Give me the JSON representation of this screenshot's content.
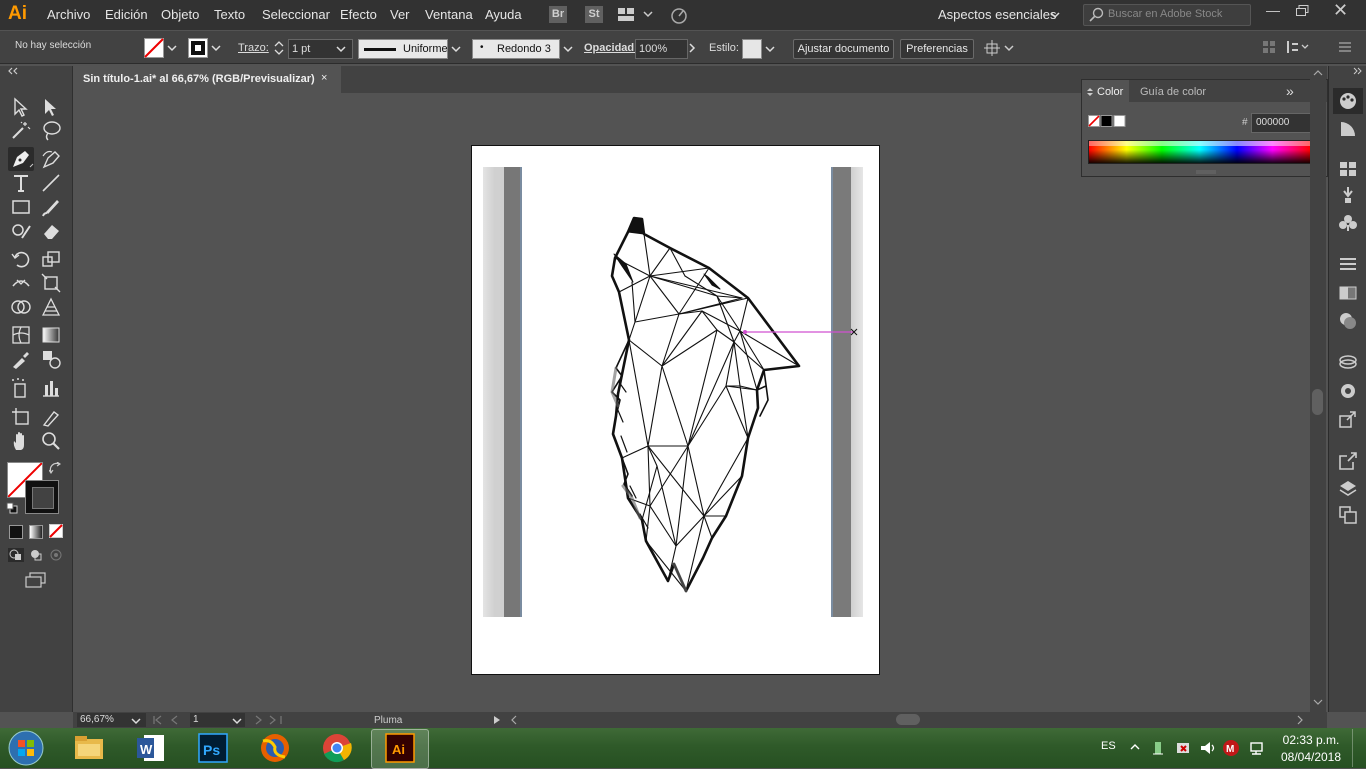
{
  "app": {
    "logo": "Ai",
    "menu": [
      "Archivo",
      "Edición",
      "Objeto",
      "Texto",
      "Seleccionar",
      "Efecto",
      "Ver",
      "Ventana",
      "Ayuda"
    ],
    "bridge": "Br",
    "stock": "St",
    "workspace": "Aspectos esenciales",
    "search_placeholder": "Buscar en Adobe Stock"
  },
  "control_bar": {
    "selection": "No hay selección",
    "stroke_label": "Trazo:",
    "stroke_weight": "1 pt",
    "profile": "Uniforme",
    "brush": "Redondo 3 ...",
    "opacity_label": "Opacidad:",
    "opacity": "100%",
    "style_label": "Estilo:",
    "fit_document": "Ajustar documento",
    "preferences": "Preferencias"
  },
  "document": {
    "tab_title": "Sin título-1.ai* al 66,67% (RGB/Previsualizar)",
    "close": "×"
  },
  "color_panel": {
    "tab_color": "Color",
    "tab_guide": "Guía de color",
    "hex_label": "#",
    "hex_value": "000000",
    "collapse": "»"
  },
  "status": {
    "zoom": "66,67%",
    "page": "1",
    "tool": "Pluma"
  },
  "taskbar": {
    "language": "ES",
    "time": "02:33 p.m.",
    "date": "08/04/2018"
  },
  "colors": {
    "accent": "#ff9a00",
    "guide_line": "#d050d0",
    "chrome_dark": "#323232",
    "chrome_mid": "#424242",
    "canvas_bg": "#535353"
  }
}
